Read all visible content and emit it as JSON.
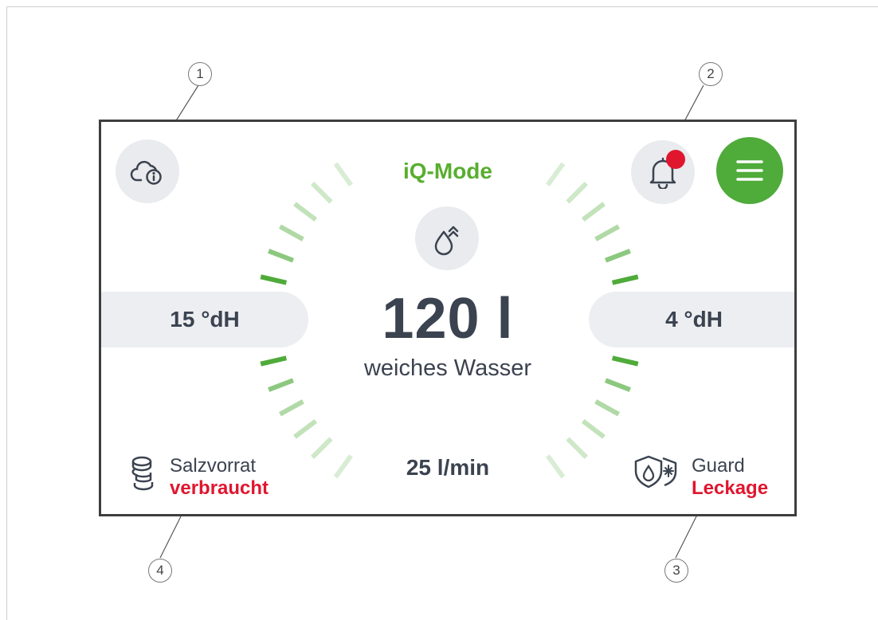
{
  "mode": {
    "label": "iQ-Mode",
    "color": "#58ae2f"
  },
  "hardness": {
    "incoming": "15 °dH",
    "outgoing": "4 °dH"
  },
  "soft_water": {
    "volume": "120 l",
    "caption": "weiches Wasser"
  },
  "flow_rate": "25 l/min",
  "salt": {
    "title": "Salzvorrat",
    "status": "verbraucht",
    "icon": "salt-tablets-icon"
  },
  "guard": {
    "title": "Guard",
    "status": "Leckage",
    "icon": "guard-shield-icon"
  },
  "buttons": {
    "cloud_info": "cloud-info-icon",
    "notifications": "bell-icon",
    "menu": "menu-icon",
    "water_mode": "water-drop-boost-icon"
  },
  "notification_dot": true,
  "callouts": [
    "1",
    "2",
    "3",
    "4"
  ],
  "colors": {
    "accent": "#4fab3a",
    "alert": "#e0162f",
    "text": "#3b4350",
    "pill": "#eceef1"
  }
}
